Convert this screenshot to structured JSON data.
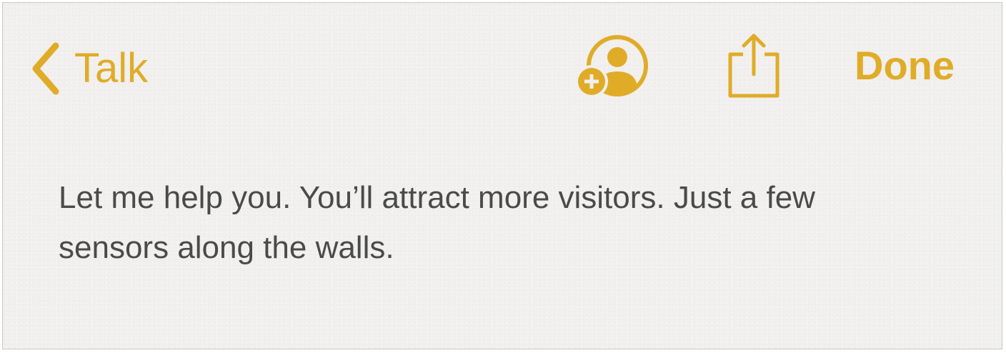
{
  "nav": {
    "back_label": "Talk",
    "done_label": "Done"
  },
  "icons": {
    "back": "chevron-left-icon",
    "add_people": "add-person-icon",
    "share": "share-icon"
  },
  "note": {
    "line1": "Let me help you. You’ll attract more visitors. Just a few",
    "line2": "sensors along the walls."
  },
  "colors": {
    "accent": "#e0ac27",
    "text": "#4a4a4a",
    "background": "#f1f0ef"
  }
}
